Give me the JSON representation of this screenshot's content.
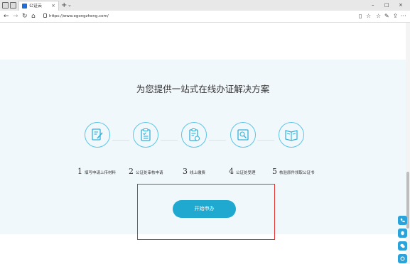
{
  "browser": {
    "tab_title": "公证云",
    "tab_close": "×",
    "new_tab": "+",
    "tab_menu": "⌄",
    "minimize": "–",
    "maximize": "□",
    "close": "×",
    "back": "←",
    "forward": "→",
    "reload": "↻",
    "home": "⌂",
    "url": "https://www.egongzheng.com/",
    "reader": "▯",
    "favorite": "☆",
    "favorites": "☆",
    "pen": "✎",
    "share": "⇪",
    "more": "···"
  },
  "hero": {
    "headline": "为您提供一站式在线办证解决方案",
    "steps": [
      {
        "num": "1",
        "label": "填写申请上传材料",
        "icon": "edit-document-icon"
      },
      {
        "num": "2",
        "label": "公证处审核申请",
        "icon": "checklist-document-icon"
      },
      {
        "num": "3",
        "label": "线上缴费",
        "icon": "payment-document-icon"
      },
      {
        "num": "4",
        "label": "公证处受理",
        "icon": "search-document-icon"
      },
      {
        "num": "5",
        "label": "核验原件领取公证书",
        "icon": "certificate-book-icon"
      }
    ],
    "start_button": "开始申办"
  },
  "float_icons": [
    "phone-icon",
    "qq-icon",
    "wechat-icon",
    "service-icon"
  ],
  "colors": {
    "accent": "#1fa9d0",
    "icon_stroke": "#34b1da",
    "highlight": "#e2302d",
    "hero_bg": "#f1f8fc"
  }
}
